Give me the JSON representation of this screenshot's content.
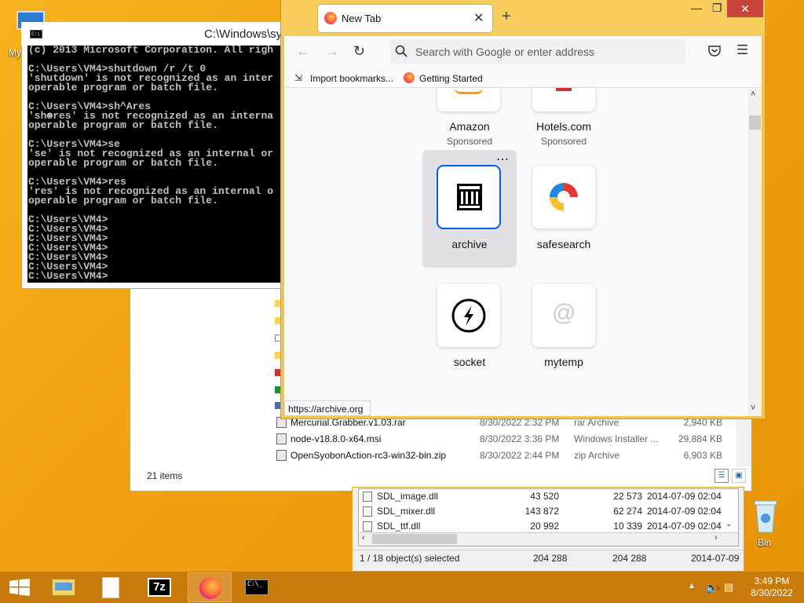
{
  "desktop": {
    "icons": [
      {
        "name": "computer-desktop-icon",
        "label": "My"
      },
      {
        "name": "recycle-bin-desktop-icon",
        "label": "Bin"
      }
    ]
  },
  "cmd": {
    "title": "C:\\Windows\\sy",
    "lines": [
      "(c) 2013 Microsoft Corporation. All righ",
      "",
      "C:\\Users\\VM4>shutdown /r /t 0",
      "'shutdown' is not recognized as an inter",
      "operable program or batch file.",
      "",
      "C:\\Users\\VM4>sh^Ares",
      "'sh☻res' is not recognized as an interna",
      "operable program or batch file.",
      "",
      "C:\\Users\\VM4>se",
      "'se' is not recognized as an internal or",
      "operable program or batch file.",
      "",
      "C:\\Users\\VM4>res",
      "'res' is not recognized as an internal o",
      "operable program or batch file.",
      "",
      "C:\\Users\\VM4>",
      "C:\\Users\\VM4>",
      "C:\\Users\\VM4>",
      "C:\\Users\\VM4>",
      "C:\\Users\\VM4>",
      "C:\\Users\\VM4>",
      "C:\\Users\\VM4>"
    ]
  },
  "firefox": {
    "tab_title": "New Tab",
    "url_placeholder": "Search with Google or enter address",
    "bookmarks": [
      "Import bookmarks...",
      "Getting Started"
    ],
    "tiles": [
      {
        "label": "Amazon",
        "sub": "Sponsored"
      },
      {
        "label": "Hotels.com",
        "sub": "Sponsored"
      },
      {
        "label": "archive",
        "sub": ""
      },
      {
        "label": "safesearch",
        "sub": ""
      },
      {
        "label": "socket",
        "sub": ""
      },
      {
        "label": "mytemp",
        "sub": ""
      }
    ],
    "tile_menu": "⋯",
    "status_url": "https://archive.org"
  },
  "explorer": {
    "rows": [
      {
        "name": "Mercurial.Grabber.v1.03.rar",
        "date": "8/30/2022 2:32 PM",
        "type": "rar Archive",
        "size": "2,940 KB"
      },
      {
        "name": "node-v18.8.0-x64.msi",
        "date": "8/30/2022 3:36 PM",
        "type": "Windows Installer ...",
        "size": "29,884 KB"
      },
      {
        "name": "OpenSyobonAction-rc3-win32-bin.zip",
        "date": "8/30/2022 2:44 PM",
        "type": "zip Archive",
        "size": "6,903 KB"
      }
    ],
    "status": "21 items"
  },
  "zip": {
    "rows": [
      {
        "name": "SDL_image.dll",
        "size": "43 520",
        "packed": "22 573",
        "modified": "2014-07-09 02:04"
      },
      {
        "name": "SDL_mixer.dll",
        "size": "143 872",
        "packed": "62 274",
        "modified": "2014-07-09 02:04"
      },
      {
        "name": "SDL_ttf.dll",
        "size": "20 992",
        "packed": "10 339",
        "modified": "2014-07-09 02:04"
      }
    ],
    "status": {
      "selected": "1 / 18 object(s) selected",
      "size": "204 288",
      "packed": "204 288",
      "modified": "2014-07-09"
    }
  },
  "taskbar": {
    "time": "3:49 PM",
    "date": "8/30/2022",
    "items": [
      "start-button",
      "file-explorer",
      "notepad-file",
      "7zip",
      "firefox",
      "command-prompt"
    ]
  }
}
